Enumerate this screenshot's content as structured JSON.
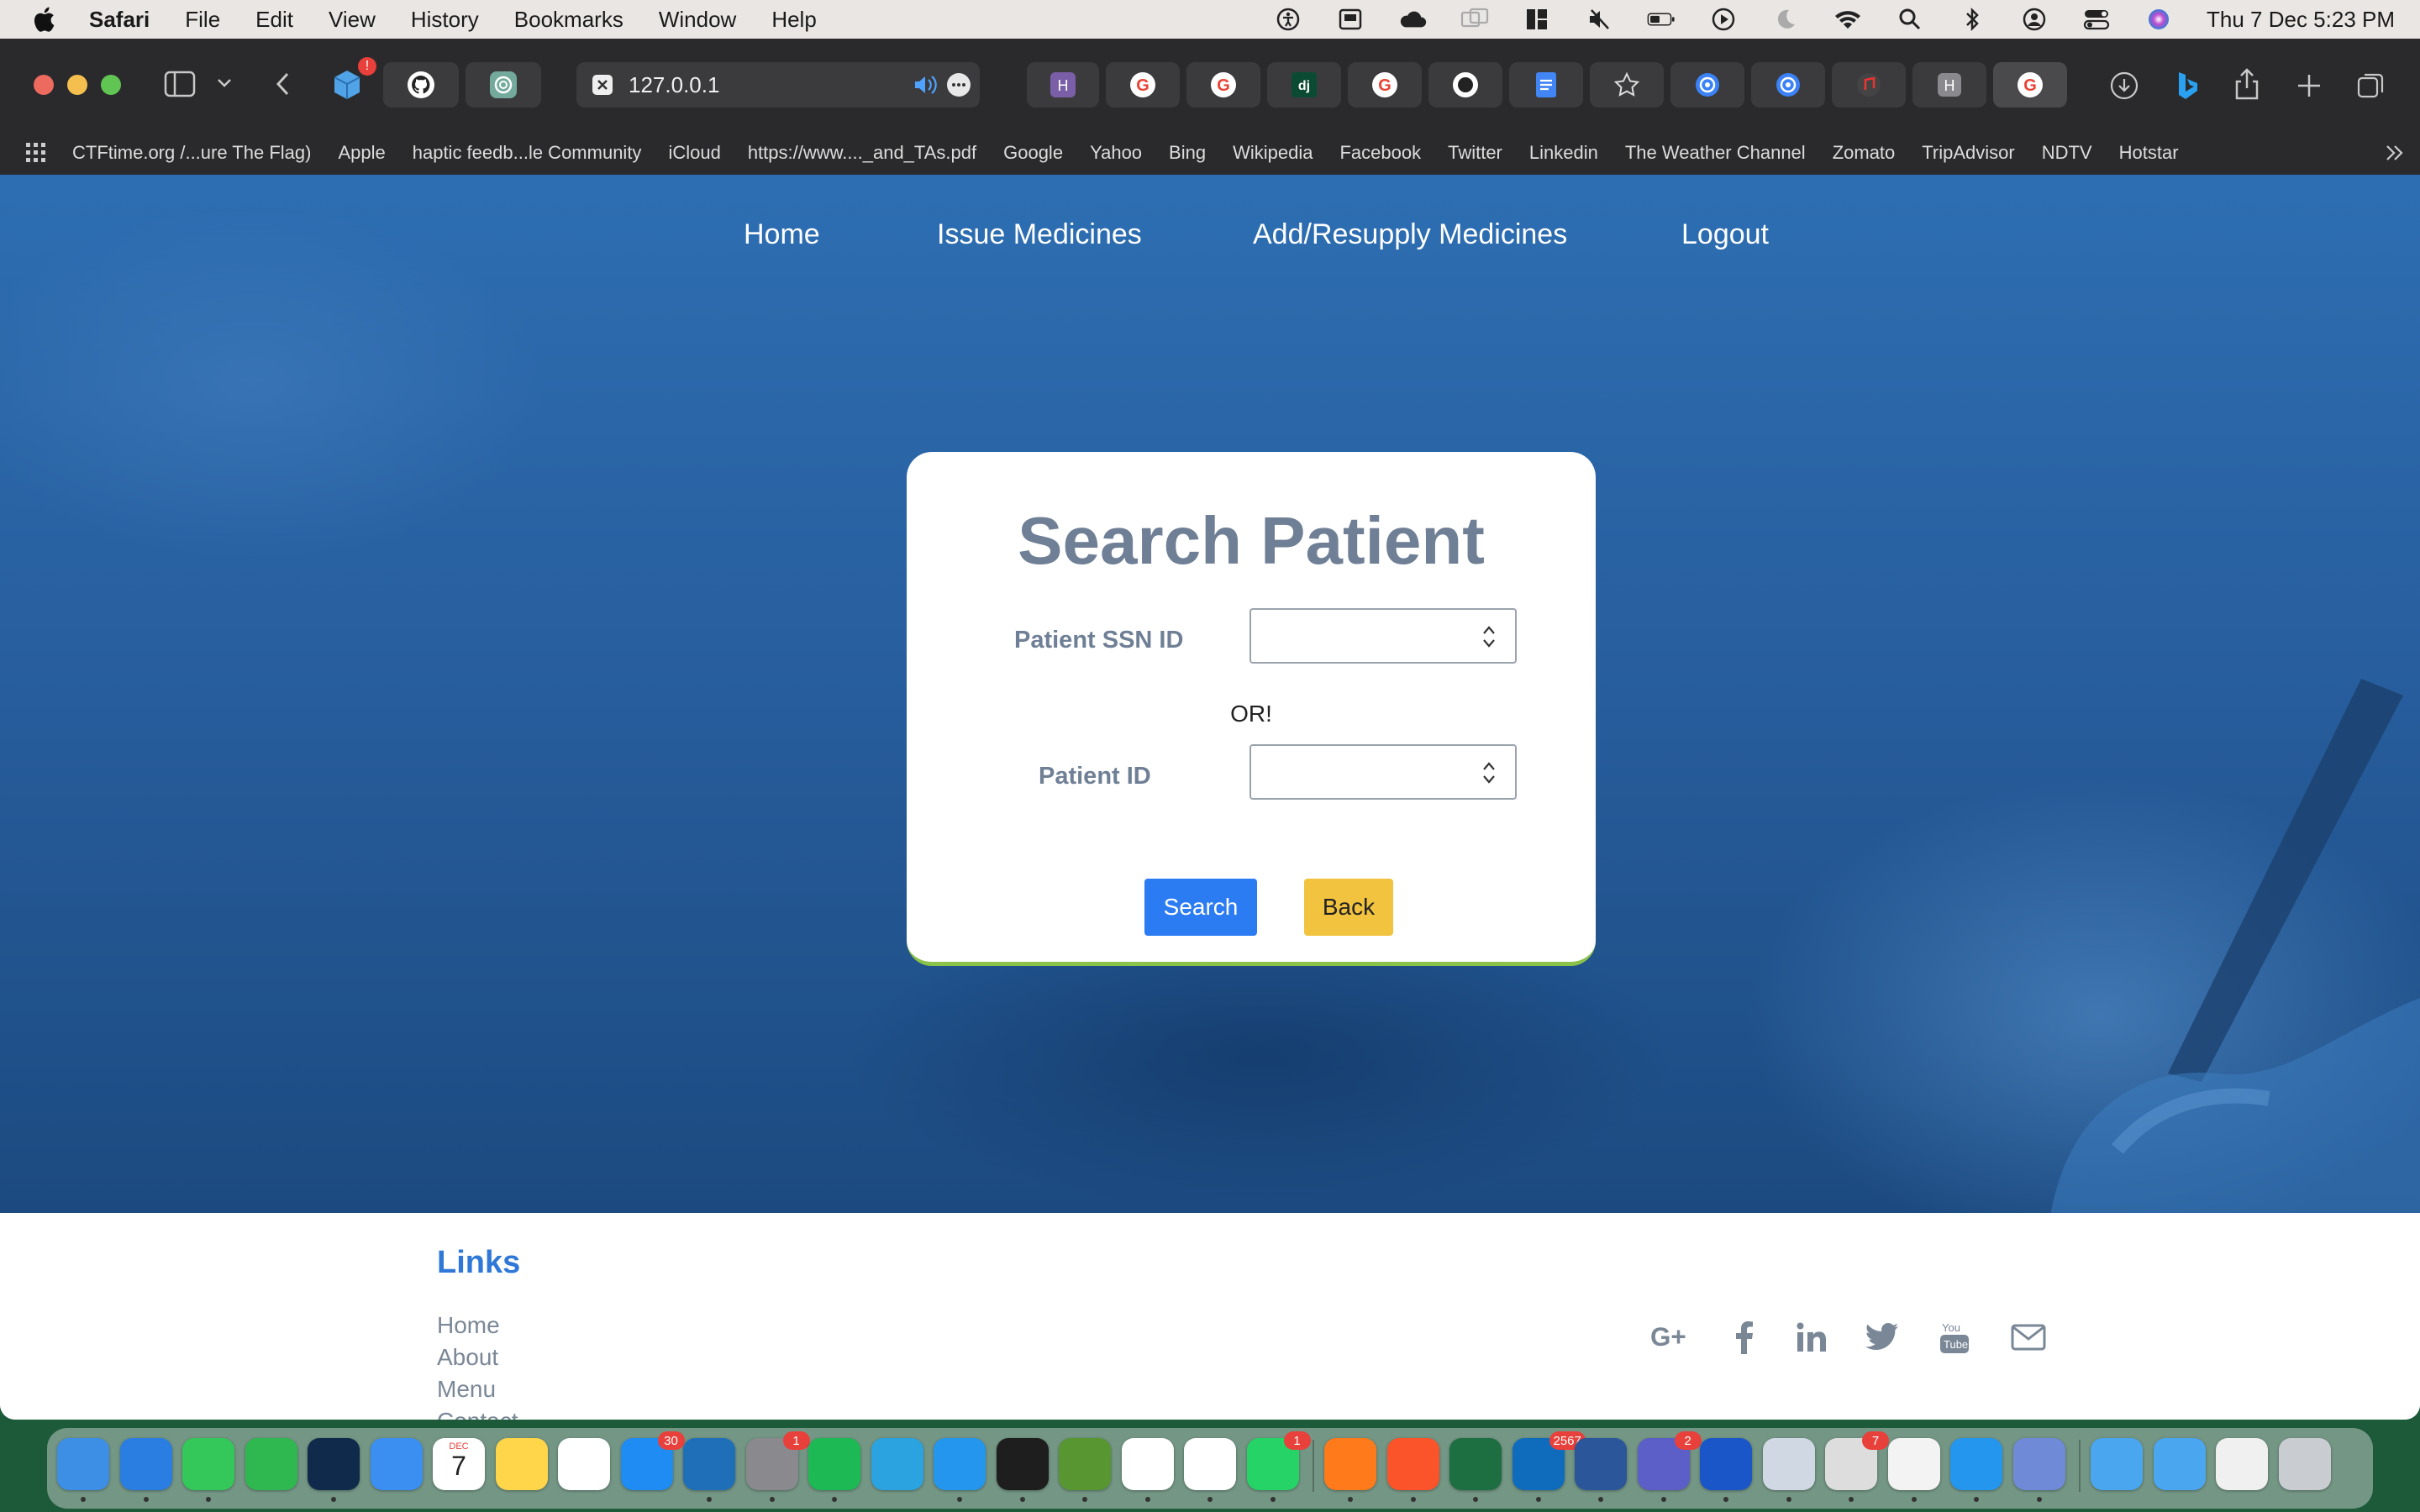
{
  "menubar": {
    "app_name": "Safari",
    "menus": [
      "File",
      "Edit",
      "View",
      "History",
      "Bookmarks",
      "Window",
      "Help"
    ],
    "clock": "Thu 7 Dec  5:23 PM"
  },
  "browser": {
    "url": "127.0.0.1",
    "bookmarks": [
      "CTFtime.org /...ure The Flag)",
      "Apple",
      "haptic feedb...le Community",
      "iCloud",
      "https://www...._and_TAs.pdf",
      "Google",
      "Yahoo",
      "Bing",
      "Wikipedia",
      "Facebook",
      "Twitter",
      "Linkedin",
      "The Weather Channel",
      "Zomato",
      "TripAdvisor",
      "NDTV",
      "Hotstar"
    ],
    "badge": "!"
  },
  "nav": {
    "home": "Home",
    "issue": "Issue Medicines",
    "add": "Add/Resupply Medicines",
    "logout": "Logout"
  },
  "form": {
    "title": "Search Patient",
    "ssn_label": "Patient SSN ID",
    "ssn_value": "",
    "or_text": "OR!",
    "pid_label": "Patient ID",
    "pid_value": "",
    "search_label": "Search",
    "back_label": "Back"
  },
  "footer": {
    "heading": "Links",
    "links": [
      "Home",
      "About",
      "Menu",
      "Contact"
    ],
    "social": [
      "google-plus-icon",
      "facebook-icon",
      "linkedin-icon",
      "twitter-icon",
      "youtube-icon",
      "mail-icon"
    ]
  },
  "dock": {
    "badges": {
      "appstore": "30",
      "settings": "1",
      "whatsapp": "1",
      "outlook": "2567",
      "teams": "2",
      "printer": "7"
    },
    "calendar_month": "DEC",
    "calendar_day": "7"
  },
  "colors": {
    "accent_blue": "#2f78d8",
    "search_button": "#2b7bf3",
    "back_button": "#f2c33e",
    "card_border": "#8bc34a",
    "label_gray": "#6f7f95"
  }
}
